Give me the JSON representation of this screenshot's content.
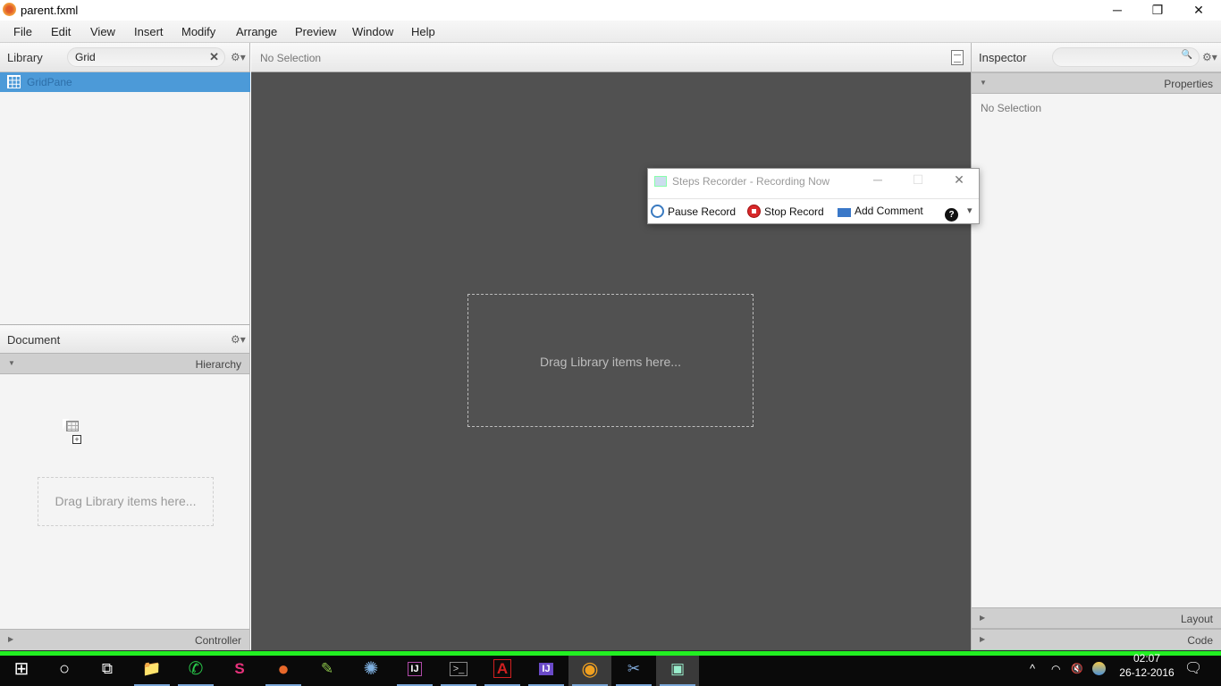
{
  "window": {
    "title": "parent.fxml",
    "controls": {
      "minimize": "─",
      "restore": "❐",
      "close": "✕"
    }
  },
  "menubar": {
    "items": [
      {
        "label": "File"
      },
      {
        "label": "Edit"
      },
      {
        "label": "View"
      },
      {
        "label": "Insert"
      },
      {
        "label": "Modify"
      },
      {
        "label": "Arrange"
      },
      {
        "label": "Preview"
      },
      {
        "label": "Window"
      },
      {
        "label": "Help"
      }
    ]
  },
  "library": {
    "title": "Library",
    "search_value": "Grid",
    "clear_icon": "✕",
    "gear_icon": "⚙▾",
    "items": [
      {
        "label": "GridPane",
        "icon": "grid-icon",
        "selected": true
      }
    ]
  },
  "document": {
    "title": "Document",
    "gear_icon": "⚙▾",
    "hierarchy_label": "Hierarchy",
    "drop_hint": "Drag Library items here...",
    "controller_label": "Controller",
    "expand_arrow": "▼",
    "collapse_arrow": "▶"
  },
  "canvas": {
    "selection_label": "No Selection",
    "drop_hint": "Drag Library items here..."
  },
  "inspector": {
    "title": "Inspector",
    "search_placeholder": "",
    "search_icon": "🔍",
    "gear_icon": "⚙▾",
    "properties_label": "Properties",
    "no_selection": "No Selection",
    "layout_label": "Layout",
    "code_label": "Code",
    "expand_arrow": "▼",
    "collapse_arrow": "▶"
  },
  "steps_recorder": {
    "title": "Steps Recorder - Recording Now",
    "pause_label": "Pause Record",
    "stop_label": "Stop Record",
    "comment_label": "Add Comment",
    "help_icon": "?",
    "dropdown_icon": "▾",
    "controls": {
      "minimize": "─",
      "maximize": "☐",
      "close": "✕"
    }
  },
  "taskbar": {
    "start_icon": "⊞",
    "search_icon": "○",
    "taskview_icon": "⧉",
    "apps": [
      {
        "name": "file-explorer",
        "glyph": "📁",
        "color": "#f3c24a"
      },
      {
        "name": "whatsapp",
        "glyph": "✆",
        "color": "#29c84a"
      },
      {
        "name": "slack",
        "glyph": "S",
        "color": "#e8327c"
      },
      {
        "name": "firefox",
        "glyph": "●",
        "color": "#e8682a"
      },
      {
        "name": "notepad",
        "glyph": "✎",
        "color": "#8bc34a"
      },
      {
        "name": "app-tree",
        "glyph": "✺",
        "color": "#3f7fbf"
      },
      {
        "name": "intellij",
        "glyph": "IJ",
        "color": "#b04aa8"
      },
      {
        "name": "cmd",
        "glyph": ">_",
        "color": "#cccccc"
      },
      {
        "name": "acrobat",
        "glyph": "A",
        "color": "#d02020"
      },
      {
        "name": "intellij-2",
        "glyph": "IJ",
        "color": "#6a4ac8"
      },
      {
        "name": "scene-builder",
        "glyph": "◉",
        "color": "#f0a020"
      },
      {
        "name": "snipping-tool",
        "glyph": "✂",
        "color": "#3a7ac0"
      },
      {
        "name": "steps-recorder",
        "glyph": "▣",
        "color": "#9ec"
      }
    ],
    "tray": {
      "chevron": "^",
      "wifi": "◠",
      "volume": "🔇",
      "time": "02:07",
      "date": "26-12-2016",
      "notification_icon": "🗨"
    }
  }
}
